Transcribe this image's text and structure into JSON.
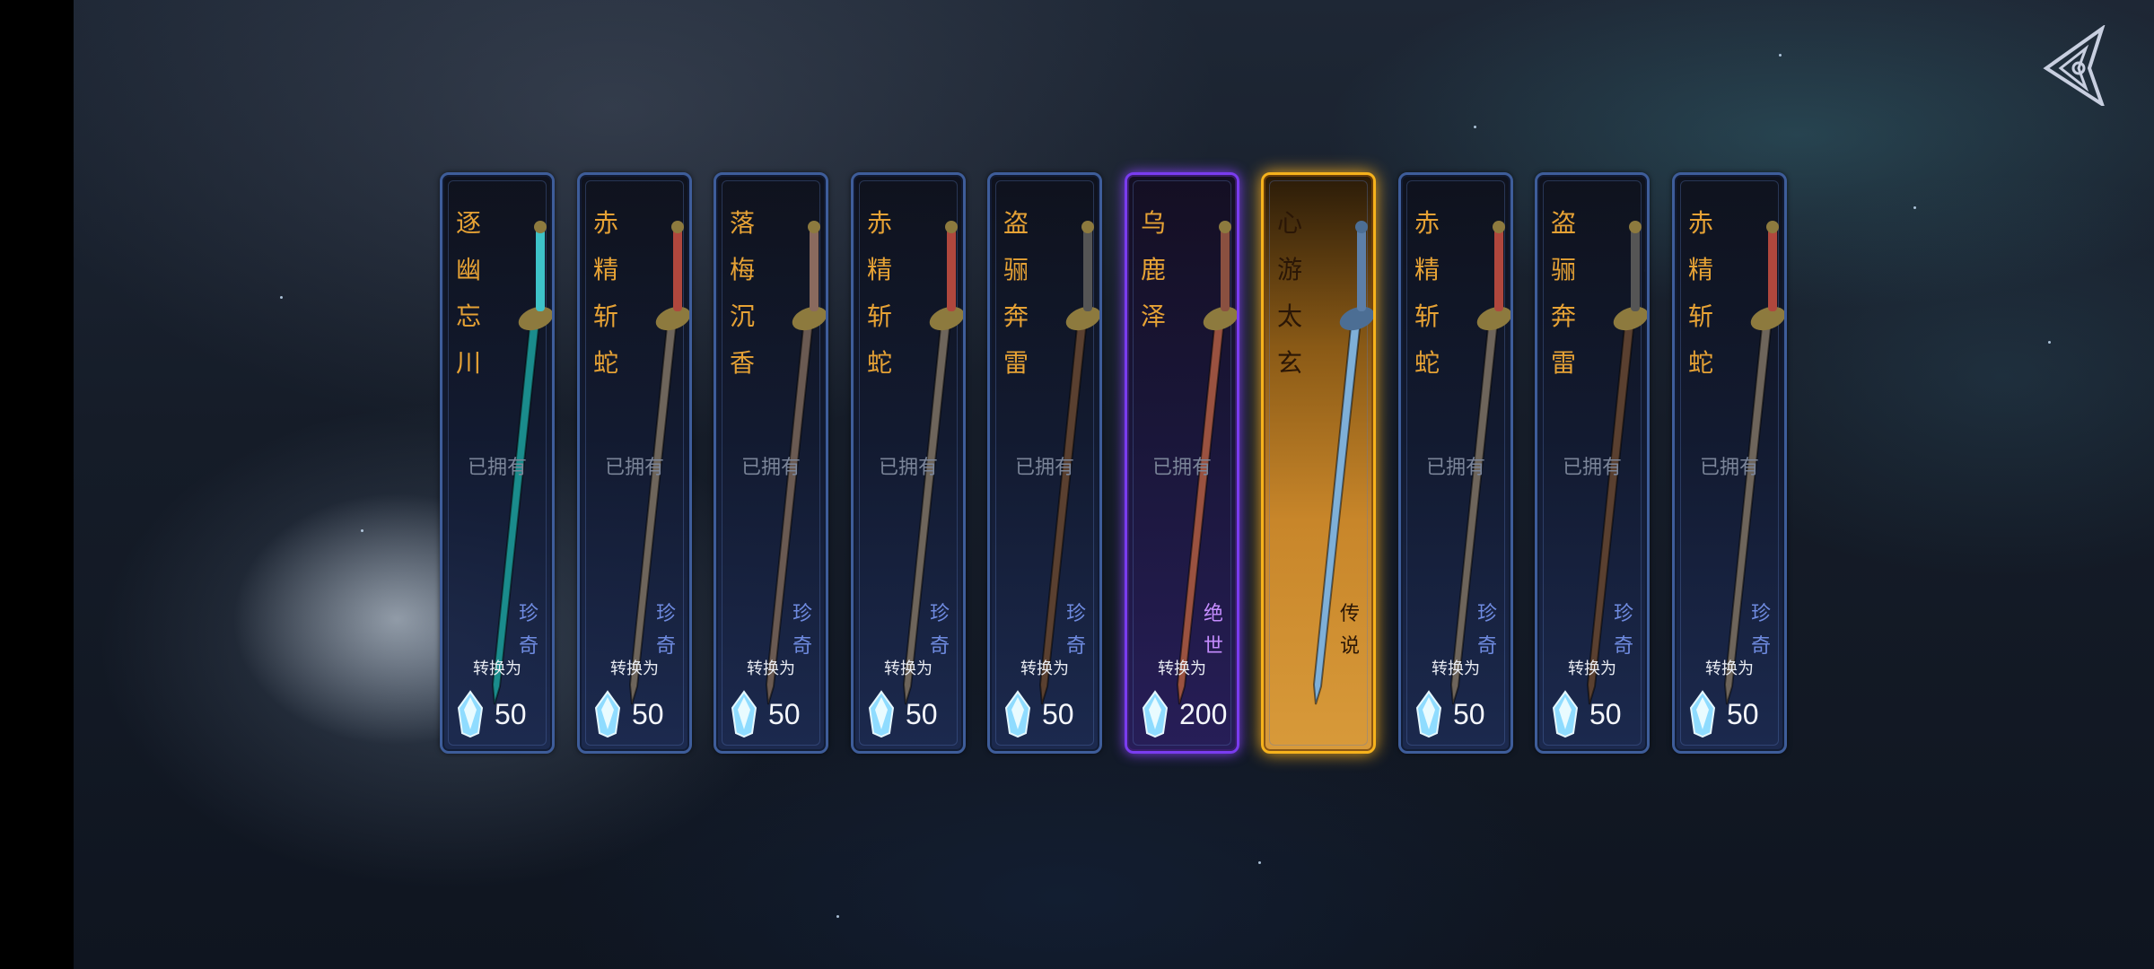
{
  "back_button": {
    "icon": "back-arrow-icon"
  },
  "cards": [
    {
      "name": "逐幽忘川",
      "status": "已拥有",
      "rarity": "珍奇",
      "convert_label": "转换为",
      "cost": "50",
      "tier": "rare",
      "blade_color": "#1a8c8c",
      "hilt_color": "#3ec3c8"
    },
    {
      "name": "赤精斩蛇",
      "status": "已拥有",
      "rarity": "珍奇",
      "convert_label": "转换为",
      "cost": "50",
      "tier": "rare",
      "blade_color": "#6e655b",
      "hilt_color": "#b0473d"
    },
    {
      "name": "落梅沉香",
      "status": "已拥有",
      "rarity": "珍奇",
      "convert_label": "转换为",
      "cost": "50",
      "tier": "rare",
      "blade_color": "#6a5a52",
      "hilt_color": "#8a6a5e"
    },
    {
      "name": "赤精斩蛇",
      "status": "已拥有",
      "rarity": "珍奇",
      "convert_label": "转换为",
      "cost": "50",
      "tier": "rare",
      "blade_color": "#6e655b",
      "hilt_color": "#b0473d"
    },
    {
      "name": "盗骊奔雷",
      "status": "已拥有",
      "rarity": "珍奇",
      "convert_label": "转换为",
      "cost": "50",
      "tier": "rare",
      "blade_color": "#5a4030",
      "hilt_color": "#555"
    },
    {
      "name": "乌鹿泽",
      "status": "已拥有",
      "rarity": "绝世",
      "convert_label": "转换为",
      "cost": "200",
      "tier": "epic",
      "blade_color": "#9a5240",
      "hilt_color": "#8a5040"
    },
    {
      "name": "心游太玄",
      "status": "",
      "rarity": "传说",
      "convert_label": "",
      "cost": "",
      "tier": "legend",
      "blade_color": "#7fb0d8",
      "hilt_color": "#5d7fa8"
    },
    {
      "name": "赤精斩蛇",
      "status": "已拥有",
      "rarity": "珍奇",
      "convert_label": "转换为",
      "cost": "50",
      "tier": "rare",
      "blade_color": "#6e655b",
      "hilt_color": "#b0473d"
    },
    {
      "name": "盗骊奔雷",
      "status": "已拥有",
      "rarity": "珍奇",
      "convert_label": "转换为",
      "cost": "50",
      "tier": "rare",
      "blade_color": "#5a4030",
      "hilt_color": "#555"
    },
    {
      "name": "赤精斩蛇",
      "status": "已拥有",
      "rarity": "珍奇",
      "convert_label": "转换为",
      "cost": "50",
      "tier": "rare",
      "blade_color": "#6e655b",
      "hilt_color": "#b0473d"
    }
  ]
}
